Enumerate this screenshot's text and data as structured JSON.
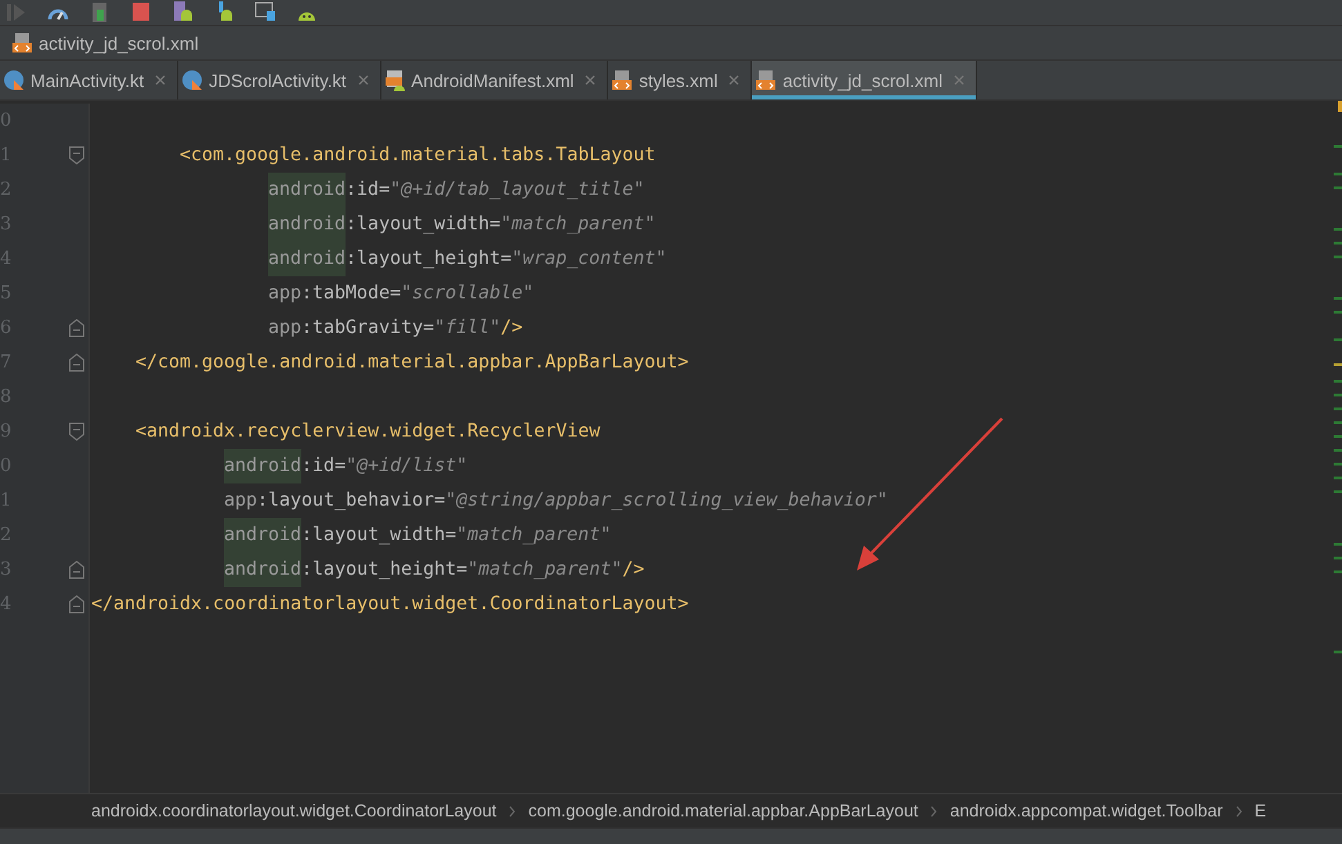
{
  "toolbar": {
    "icons": [
      {
        "kind": "run"
      },
      {
        "kind": "profile"
      },
      {
        "kind": "debug"
      },
      {
        "kind": "stop"
      },
      {
        "kind": "sync"
      },
      {
        "kind": "avd"
      },
      {
        "kind": "layout"
      },
      {
        "kind": "android"
      }
    ]
  },
  "navigation_bar": {
    "file": "activity_jd_scrol.xml"
  },
  "tabs": [
    {
      "label": "MainActivity.kt",
      "kind": "kotlin",
      "selected": false
    },
    {
      "label": "JDScrolActivity.kt",
      "kind": "kotlin",
      "selected": false
    },
    {
      "label": "AndroidManifest.xml",
      "kind": "manifest",
      "selected": false
    },
    {
      "label": "styles.xml",
      "kind": "xml",
      "selected": false
    },
    {
      "label": "activity_jd_scrol.xml",
      "kind": "xml",
      "selected": true
    }
  ],
  "editor": {
    "lines": [
      {
        "number": "0",
        "kind": "blank"
      },
      {
        "number": "1",
        "fold_start": true,
        "kind": "grandchild",
        "tokens": [
          {
            "kind": "tag",
            "text": "<com.google.android.material.tabs.TabLayout"
          }
        ]
      },
      {
        "number": "2",
        "kind": "grandchild_attribute",
        "tokens": [
          {
            "kind": "ns",
            "text": "android",
            "highlighted": true
          },
          {
            "kind": "attr",
            "text": ":id="
          },
          {
            "kind": "value",
            "text": "\"@+id/tab_layout_title\""
          }
        ]
      },
      {
        "number": "3",
        "kind": "grandchild_attribute",
        "tokens": [
          {
            "kind": "ns",
            "text": "android",
            "highlighted": true
          },
          {
            "kind": "attr",
            "text": ":layout_width="
          },
          {
            "kind": "value",
            "text": "\"match_parent\""
          }
        ]
      },
      {
        "number": "4",
        "kind": "grandchild_attribute",
        "tokens": [
          {
            "kind": "ns",
            "text": "android",
            "highlighted": true
          },
          {
            "kind": "attr",
            "text": ":layout_height="
          },
          {
            "kind": "value",
            "text": "\"wrap_content\""
          }
        ]
      },
      {
        "number": "5",
        "kind": "grandchild_attribute",
        "tokens": [
          {
            "kind": "ns",
            "text": "app",
            "highlighted": false
          },
          {
            "kind": "attr",
            "text": ":tabMode="
          },
          {
            "kind": "value",
            "text": "\"scrollable\""
          }
        ]
      },
      {
        "number": "6",
        "fold_end": true,
        "kind": "grandchild_attribute",
        "tokens": [
          {
            "kind": "ns",
            "text": "app",
            "highlighted": false
          },
          {
            "kind": "attr",
            "text": ":tabGravity="
          },
          {
            "kind": "value",
            "text": "\"fill\""
          },
          {
            "kind": "tag",
            "text": "/>"
          }
        ]
      },
      {
        "number": "7",
        "fold_end": true,
        "kind": "child",
        "tokens": [
          {
            "kind": "tag",
            "text": "</com.google.android.material.appbar.AppBarLayout>"
          }
        ]
      },
      {
        "number": "8",
        "kind": "blank"
      },
      {
        "number": "9",
        "fold_start": true,
        "kind": "child",
        "tokens": [
          {
            "kind": "tag",
            "text": "<androidx.recyclerview.widget.RecyclerView"
          }
        ]
      },
      {
        "number": "0",
        "kind": "child_attribute",
        "tokens": [
          {
            "kind": "ns",
            "text": "android",
            "highlighted": true
          },
          {
            "kind": "attr",
            "text": ":id="
          },
          {
            "kind": "value",
            "text": "\"@+id/list\""
          }
        ]
      },
      {
        "number": "1",
        "kind": "child_attribute",
        "tokens": [
          {
            "kind": "ns",
            "text": "app",
            "highlighted": false
          },
          {
            "kind": "attr",
            "text": ":layout_behavior="
          },
          {
            "kind": "value",
            "text": "\"@string/appbar_scrolling_view_behavior\""
          }
        ]
      },
      {
        "number": "2",
        "kind": "child_attribute",
        "tokens": [
          {
            "kind": "ns",
            "text": "android",
            "highlighted": true
          },
          {
            "kind": "attr",
            "text": ":layout_width="
          },
          {
            "kind": "value",
            "text": "\"match_parent\""
          }
        ]
      },
      {
        "number": "3",
        "fold_end": true,
        "kind": "child_attribute",
        "tokens": [
          {
            "kind": "ns",
            "text": "android",
            "highlighted": true
          },
          {
            "kind": "attr",
            "text": ":layout_height="
          },
          {
            "kind": "value",
            "text": "\"match_parent\""
          },
          {
            "kind": "tag",
            "text": "/>"
          }
        ]
      },
      {
        "number": "4",
        "fold_end": true,
        "kind": "root",
        "tokens": [
          {
            "kind": "tag",
            "text": "</androidx.coordinatorlayout.widget.CoordinatorLayout>"
          }
        ]
      }
    ]
  },
  "breadcrumbs": [
    "androidx.coordinatorlayout.widget.CoordinatorLayout",
    "com.google.android.material.appbar.AppBarLayout",
    "androidx.appcompat.widget.Toolbar",
    "E"
  ]
}
